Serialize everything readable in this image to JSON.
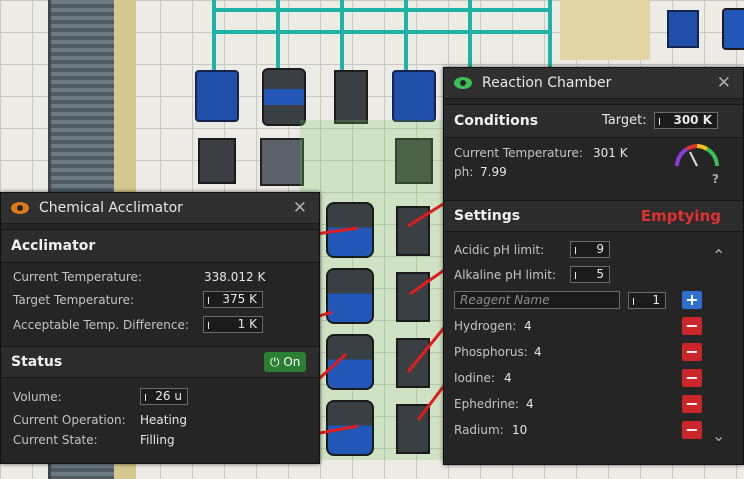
{
  "acclimator": {
    "title": "Chemical Acclimator",
    "section_acclimator": "Acclimator",
    "current_temp_label": "Current Temperature:",
    "current_temp_value": "338.012 K",
    "target_temp_label": "Target Temperature:",
    "target_temp_value": "375 K",
    "acceptable_diff_label": "Acceptable Temp. Difference:",
    "acceptable_diff_value": "1 K",
    "section_status": "Status",
    "power_button_label": "On",
    "volume_label": "Volume:",
    "volume_value": "26 u",
    "current_operation_label": "Current Operation:",
    "current_operation_value": "Heating",
    "current_state_label": "Current State:",
    "current_state_value": "Filling"
  },
  "reaction": {
    "title": "Reaction Chamber",
    "section_conditions": "Conditions",
    "target_label": "Target:",
    "target_value": "300 K",
    "current_temp_label": "Current Temperature:",
    "current_temp_value": "301 K",
    "ph_label": "ph:",
    "ph_value": "7.99",
    "help_mark": "?",
    "section_settings": "Settings",
    "settings_status": "Emptying",
    "acidic_label": "Acidic pH limit:",
    "acidic_value": "9",
    "alkaline_label": "Alkaline pH limit:",
    "alkaline_value": "5",
    "reagent_placeholder": "Reagent Name",
    "reagent_amount": "1",
    "add_symbol": "+",
    "remove_symbol": "−",
    "reagents": [
      {
        "name": "Hydrogen:",
        "amount": "4"
      },
      {
        "name": "Phosphorus:",
        "amount": "4"
      },
      {
        "name": "Iodine:",
        "amount": "4"
      },
      {
        "name": "Ephedrine:",
        "amount": "4"
      },
      {
        "name": "Radium:",
        "amount": "10"
      }
    ],
    "scroll_up": "⌃",
    "scroll_down": "⌄"
  },
  "colors": {
    "eye_acclimator": "#e07a17",
    "eye_reaction": "#3bbf56",
    "danger": "#e03131",
    "on_green": "#2a7f32"
  }
}
